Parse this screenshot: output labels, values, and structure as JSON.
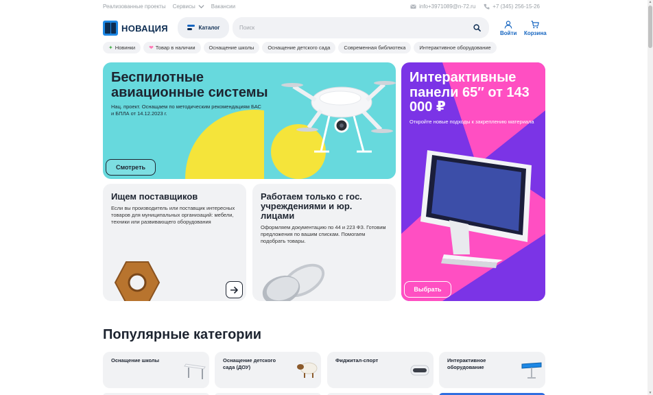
{
  "topbar": {
    "links": [
      "Реализованные проекты",
      "Сервисы",
      "Вакансии"
    ],
    "email": "info+3971089@n-72.ru",
    "phone": "+7 (345) 256-15-26"
  },
  "header": {
    "logo_text": "НОВАЦИЯ",
    "catalog_label": "Каталог",
    "search_placeholder": "Поиск",
    "login_label": "Войти",
    "cart_label": "Корзина"
  },
  "chips": [
    {
      "label": "Новинки",
      "icon": "sparkle-icon",
      "color": "#4caf50"
    },
    {
      "label": "Товар в наличии",
      "icon": "heart-icon",
      "color": "#ff7ab6"
    },
    {
      "label": "Оснащение школы"
    },
    {
      "label": "Оснащение детского сада"
    },
    {
      "label": "Современная библиотека"
    },
    {
      "label": "Интерактивное оборудование"
    }
  ],
  "banners": {
    "drone": {
      "title": "Беспилотные авиационные системы",
      "desc": "Нац. проект. Оснащаем по методическим рекомендациям БАС и БПЛА от 14.12.2023 г.",
      "button": "Смотреть"
    },
    "panel": {
      "title": "Интерактивные панели 65″ от 143 000 ₽",
      "desc": "Откройте новые подходы к закреплению материала",
      "button": "Выбрать"
    },
    "suppliers": {
      "title": "Ищем поставщиков",
      "desc": "Если вы производитель или поставщик интересных товаров для муниципальных организаций: мебели, техники или развивающего оборудования"
    },
    "government": {
      "title": "Работаем только с гос. учреждениями и юр. лицами",
      "desc": "Оформляем документацию по 44 и 223 ФЗ. Готовим предложения по вашим спискам. Помогаем подобрать товары."
    }
  },
  "popular": {
    "title": "Популярные категории",
    "items": [
      {
        "label": "Оснащение школы"
      },
      {
        "label": "Оснащение детского сада (ДОУ)"
      },
      {
        "label": "Фиджитал-спорт"
      },
      {
        "label": "Интерактивное оборудование"
      }
    ]
  },
  "colors": {
    "brand_dark": "#0d2d52",
    "brand_blue": "#1565c0",
    "drone_bg": "#67d9dd",
    "drone_yellow": "#f5e43a",
    "panel_purple": "#7b34e6",
    "panel_pink": "#ff4fc2"
  }
}
